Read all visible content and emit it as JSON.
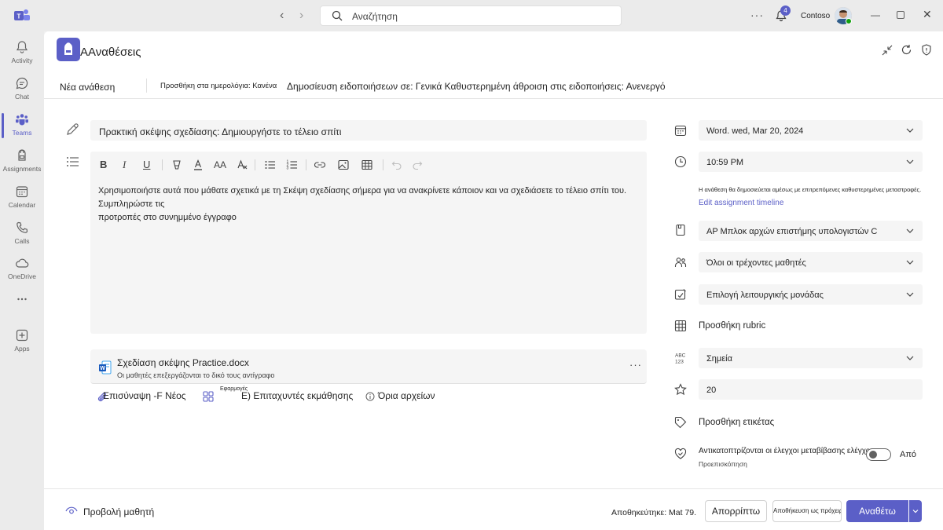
{
  "titlebar": {
    "search_placeholder": "Αναζήτηση",
    "notification_count": "4",
    "org_name": "Contoso"
  },
  "rail": {
    "items": [
      {
        "label": "Activity",
        "icon": "bell-icon"
      },
      {
        "label": "Chat",
        "icon": "chat-icon"
      },
      {
        "label": "Teams",
        "icon": "teams-icon"
      },
      {
        "label": "Assignments",
        "icon": "backpack-icon"
      },
      {
        "label": "Calendar",
        "icon": "calendar-icon"
      },
      {
        "label": "Calls",
        "icon": "phone-icon"
      },
      {
        "label": "OneDrive",
        "icon": "cloud-icon"
      },
      {
        "label": "",
        "icon": "more-icon"
      },
      {
        "label": "Apps",
        "icon": "apps-icon"
      }
    ],
    "active_index": 2
  },
  "header": {
    "title": "ΑΑναθέσεις"
  },
  "subbar": {
    "new_assignment": "Νέα ανάθεση",
    "add_to_calendar": "Προσθήκη στα ημερολόγια: Κανένα",
    "post_notifications": "Δημοσίευση ειδοποιήσεων σε: Γενικά  Καθυστερημένη άθροιση στις ειδοποιήσεις: Ανενεργό"
  },
  "form": {
    "title": "Πρακτική σκέψης σχεδίασης: Δημιουργήστε το τέλειο σπίτι",
    "instructions": "Χρησιμοποιήστε αυτά που μάθατε σχετικά με τη Σκέψη σχεδίασης σήμερα για να ανακρίνετε κάποιον και να σχεδιάσετε το τέλειο σπίτι του. Συμπληρώστε τις\nπροτροπές στο συνημμένο έγγραφο",
    "attachment": {
      "file_name": "Σχεδίαση σκέψης Practice.docx",
      "subtitle": "Οι μαθητές επεξεργάζονται το δικό τους αντίγραφο"
    },
    "attach_label": "Επισύναψη -F  Νέος",
    "apps_small_label": "Εφαρμογές",
    "learning_accelerators": "E)  Επιταχυντές εκμάθησης",
    "file_limits": "Όρια αρχείων"
  },
  "right": {
    "due_date": "Word. wed, Mar 20, 2024",
    "due_time": "10:59 PM",
    "publish_note": "Η ανάθεση θα δημοσιεύεται αμέσως με επιτρεπόμενες καθυστερημένες μεταστροφές.",
    "edit_timeline": "Edit assignment timeline",
    "class": "AP Μπλοκ αρχών επιστήμης υπολογιστών C",
    "students": "Όλοι οι τρέχοντες μαθητές",
    "category": "Επιλογή λειτουργικής μονάδας",
    "rubric": "Προσθήκη rubric",
    "grading": "Σημεία",
    "points": "20",
    "add_tag": "Προσθήκη ετικέτας",
    "plagiarism": "Αντικατοπτρίζονται οι έλεγχοι μεταβίβασης ελέγχου",
    "preview": "Προεπισκόπηση",
    "toggle_state": "Από"
  },
  "bottom": {
    "student_view": "Προβολή μαθητή",
    "saved_at": "Αποθηκεύτηκε: Mat 79.",
    "discard": "Απορρίπτω",
    "save_draft": "Αποθήκευση ως πρόχειρο",
    "assign": "Αναθέτω"
  },
  "colors": {
    "accent": "#5b5fc7",
    "rail_bg": "#ebebeb",
    "field_bg": "#f5f5f5"
  }
}
